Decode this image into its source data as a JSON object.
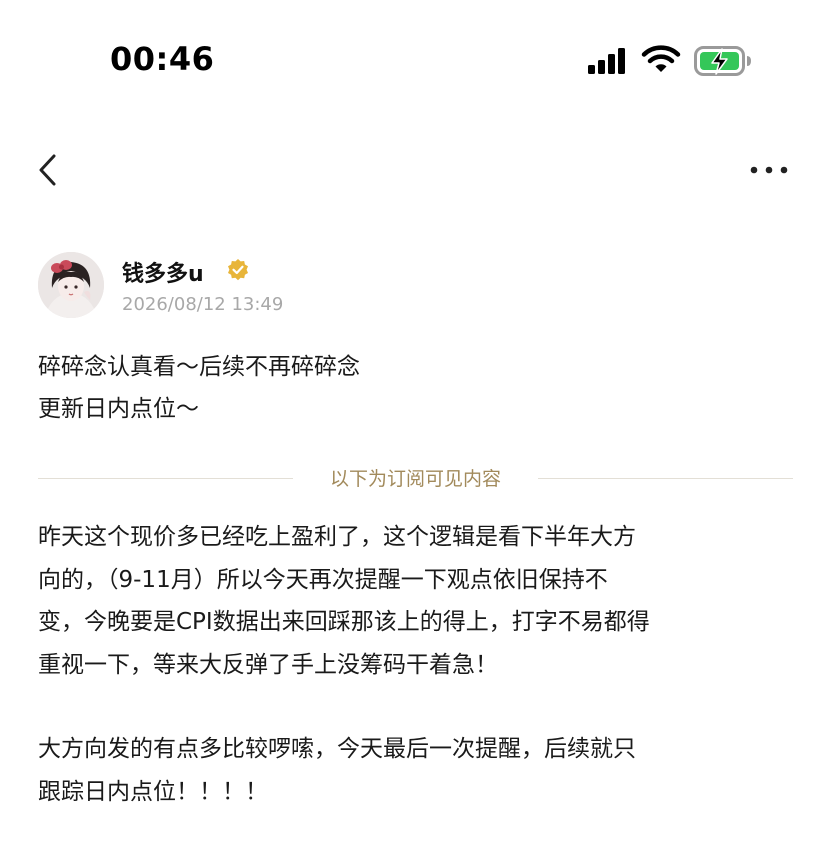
{
  "status_bar": {
    "time": "00:46",
    "signal_icon": "cellular-signal-icon",
    "wifi_icon": "wifi-icon",
    "battery_icon": "battery-charging-icon",
    "battery_color": "#34c759"
  },
  "nav": {
    "back_icon": "chevron-left-icon",
    "more_icon": "more-dots-icon"
  },
  "author": {
    "name": "钱多多u",
    "verified_icon": "verified-badge-icon",
    "verified_color": "#e8b53a",
    "date": "2026/08/12 13:49"
  },
  "post": {
    "intro_lines": [
      "碎碎念认真看～后续不再碎碎念",
      "更新日内点位～"
    ],
    "divider_label": "以下为订阅可见内容",
    "divider_color": "#a28a5b",
    "paragraph1_lines": [
      "昨天这个现价多已经吃上盈利了，这个逻辑是看下半年大方",
      "向的，（9-11月）所以今天再次提醒一下观点依旧保持不",
      "变，今晚要是CPI数据出来回踩那该上的得上，打字不易都得",
      "重视一下，等来大反弹了手上没筹码干着急！"
    ],
    "paragraph2_lines": [
      "大方向发的有点多比较啰嗦，今天最后一次提醒，后续就只",
      "跟踪日内点位！！！！"
    ]
  }
}
